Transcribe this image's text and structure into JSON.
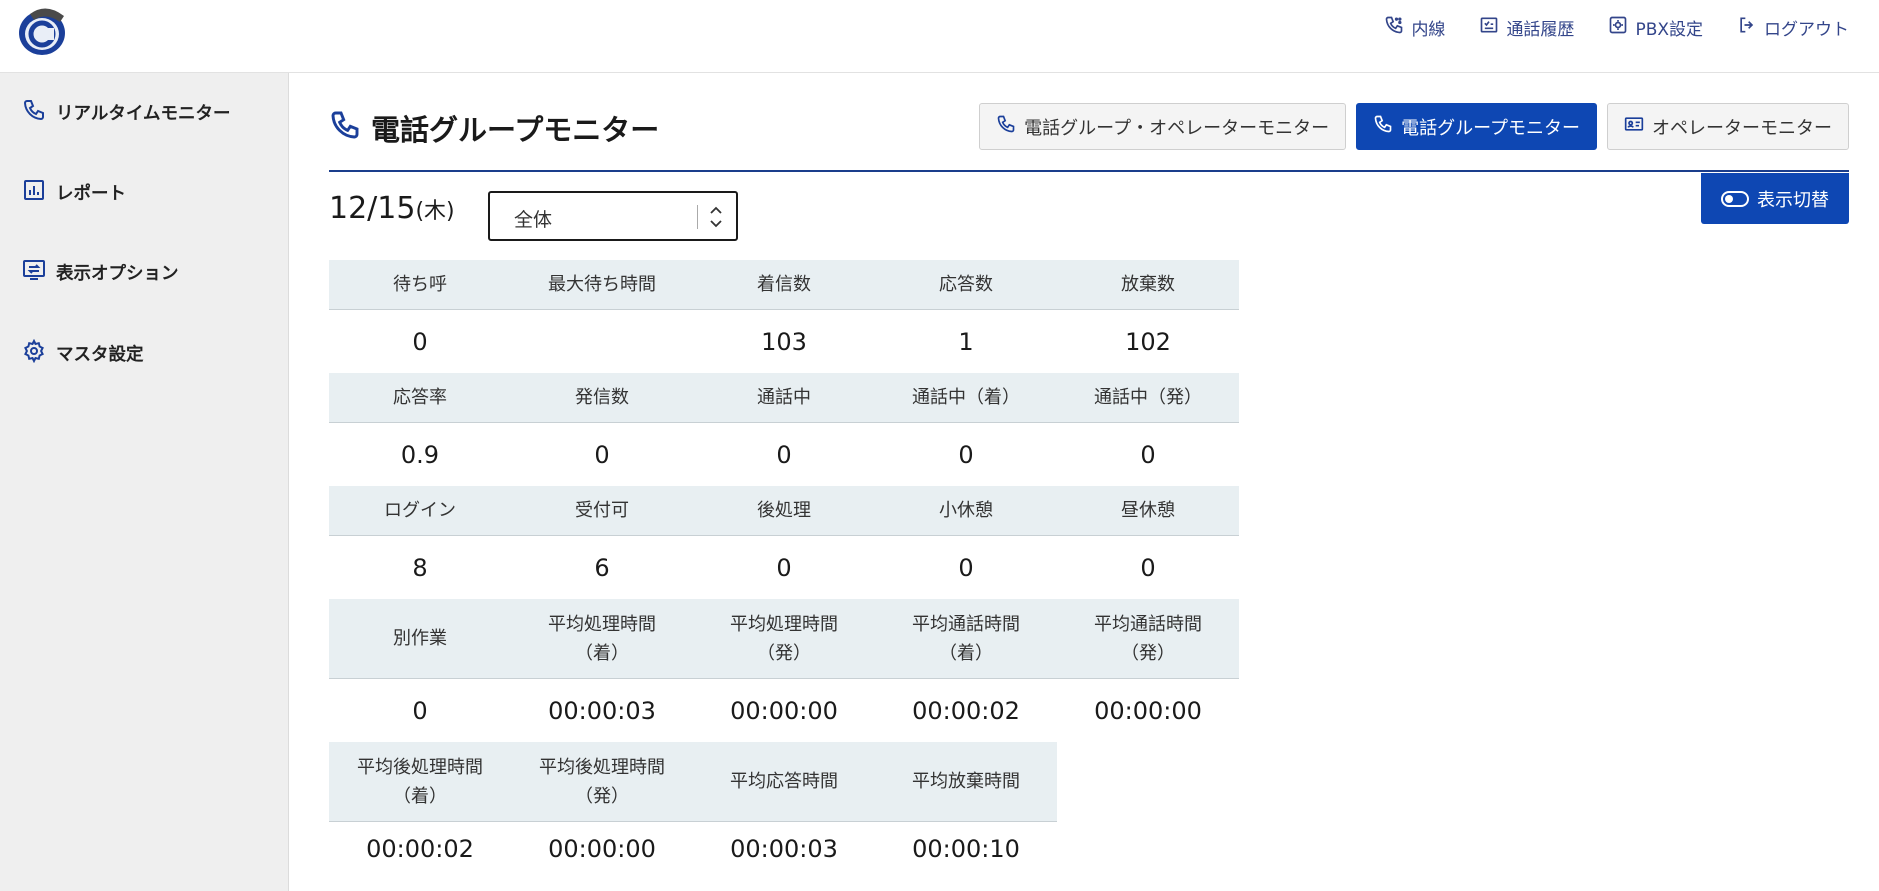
{
  "topnav": [
    {
      "label": "内線",
      "icon": "phone-ext-icon"
    },
    {
      "label": "通話履歴",
      "icon": "call-history-icon"
    },
    {
      "label": "PBX設定",
      "icon": "gear-square-icon"
    },
    {
      "label": "ログアウト",
      "icon": "logout-icon"
    }
  ],
  "sidebar": {
    "items": [
      {
        "label": "リアルタイムモニター",
        "icon": "phone-icon"
      },
      {
        "label": "レポート",
        "icon": "bar-chart-icon"
      },
      {
        "label": "表示オプション",
        "icon": "monitor-swap-icon"
      },
      {
        "label": "マスタ設定",
        "icon": "gear-icon"
      }
    ]
  },
  "page": {
    "title": "電話グループモニター",
    "tabs": [
      {
        "label": "電話グループ・オペレーターモニター",
        "active": false
      },
      {
        "label": "電話グループモニター",
        "active": true
      },
      {
        "label": "オペレーターモニター",
        "active": false
      }
    ],
    "toggle_label": "表示切替",
    "date": "12/15",
    "day_of_week": "(木)",
    "group_select": "全体"
  },
  "stats": {
    "rows": [
      {
        "labels": [
          "待ち呼",
          "最大待ち時間",
          "着信数",
          "応答数",
          "放棄数"
        ],
        "values": [
          "0",
          "",
          "103",
          "1",
          "102"
        ]
      },
      {
        "labels": [
          "応答率",
          "発信数",
          "通話中",
          "通話中（着）",
          "通話中（発）"
        ],
        "values": [
          "0.9",
          "0",
          "0",
          "0",
          "0"
        ]
      },
      {
        "labels": [
          "ログイン",
          "受付可",
          "後処理",
          "小休憩",
          "昼休憩"
        ],
        "values": [
          "8",
          "6",
          "0",
          "0",
          "0"
        ]
      },
      {
        "labels": [
          "別作業",
          "平均処理時間\n（着）",
          "平均処理時間\n（発）",
          "平均通話時間\n（着）",
          "平均通話時間\n（発）"
        ],
        "values": [
          "0",
          "00:00:03",
          "00:00:00",
          "00:00:02",
          "00:00:00"
        ]
      },
      {
        "labels": [
          "平均後処理時間\n（着）",
          "平均後処理時間\n（発）",
          "平均応答時間",
          "平均放棄時間"
        ],
        "values": [
          "00:00:02",
          "00:00:00",
          "00:00:03",
          "00:00:10"
        ]
      }
    ]
  },
  "colors": {
    "accent": "#0e47b3",
    "header_bg": "#e8eff2",
    "sidebar_bg": "#efefef"
  }
}
